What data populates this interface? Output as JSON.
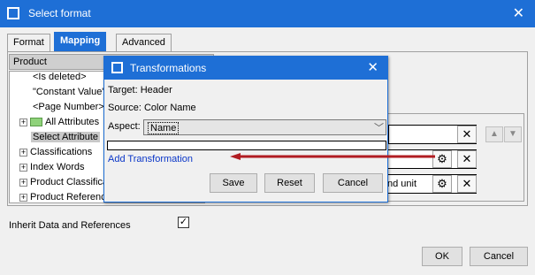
{
  "window": {
    "title": "Select format",
    "close_glyph": "✕"
  },
  "tabs": [
    {
      "label": "Format",
      "active": false
    },
    {
      "label": "Mapping",
      "active": true
    },
    {
      "label": "Advanced",
      "active": false
    }
  ],
  "tree": {
    "header": "Product",
    "items": [
      {
        "label": "<Is deleted>"
      },
      {
        "label": "\"Constant Value\""
      },
      {
        "label": "<Page Number>"
      },
      {
        "label": "All Attributes"
      },
      {
        "label": "Select Attribute"
      },
      {
        "label": "Classifications"
      },
      {
        "label": "Index Words"
      },
      {
        "label": "Product Classifica"
      },
      {
        "label": "Product Referenc"
      }
    ]
  },
  "mapping_rows": [
    {
      "value": "nd unit"
    }
  ],
  "inherit": {
    "label": "Inherit Data and References",
    "checked": true,
    "check_glyph": "✓"
  },
  "buttons": {
    "ok": "OK",
    "cancel": "Cancel"
  },
  "transformations": {
    "title": "Transformations",
    "target_label": "Target:",
    "target_value": "Header",
    "source_label": "Source:",
    "source_value": "Color Name",
    "aspect_label": "Aspect:",
    "aspect_value": "Name",
    "add_link": "Add Transformation",
    "save": "Save",
    "reset": "Reset",
    "cancel": "Cancel",
    "close_glyph": "✕"
  },
  "colors": {
    "title_bar": "#1e6fd6",
    "annotation_arrow": "#b11d22",
    "link": "#0a36c8"
  }
}
